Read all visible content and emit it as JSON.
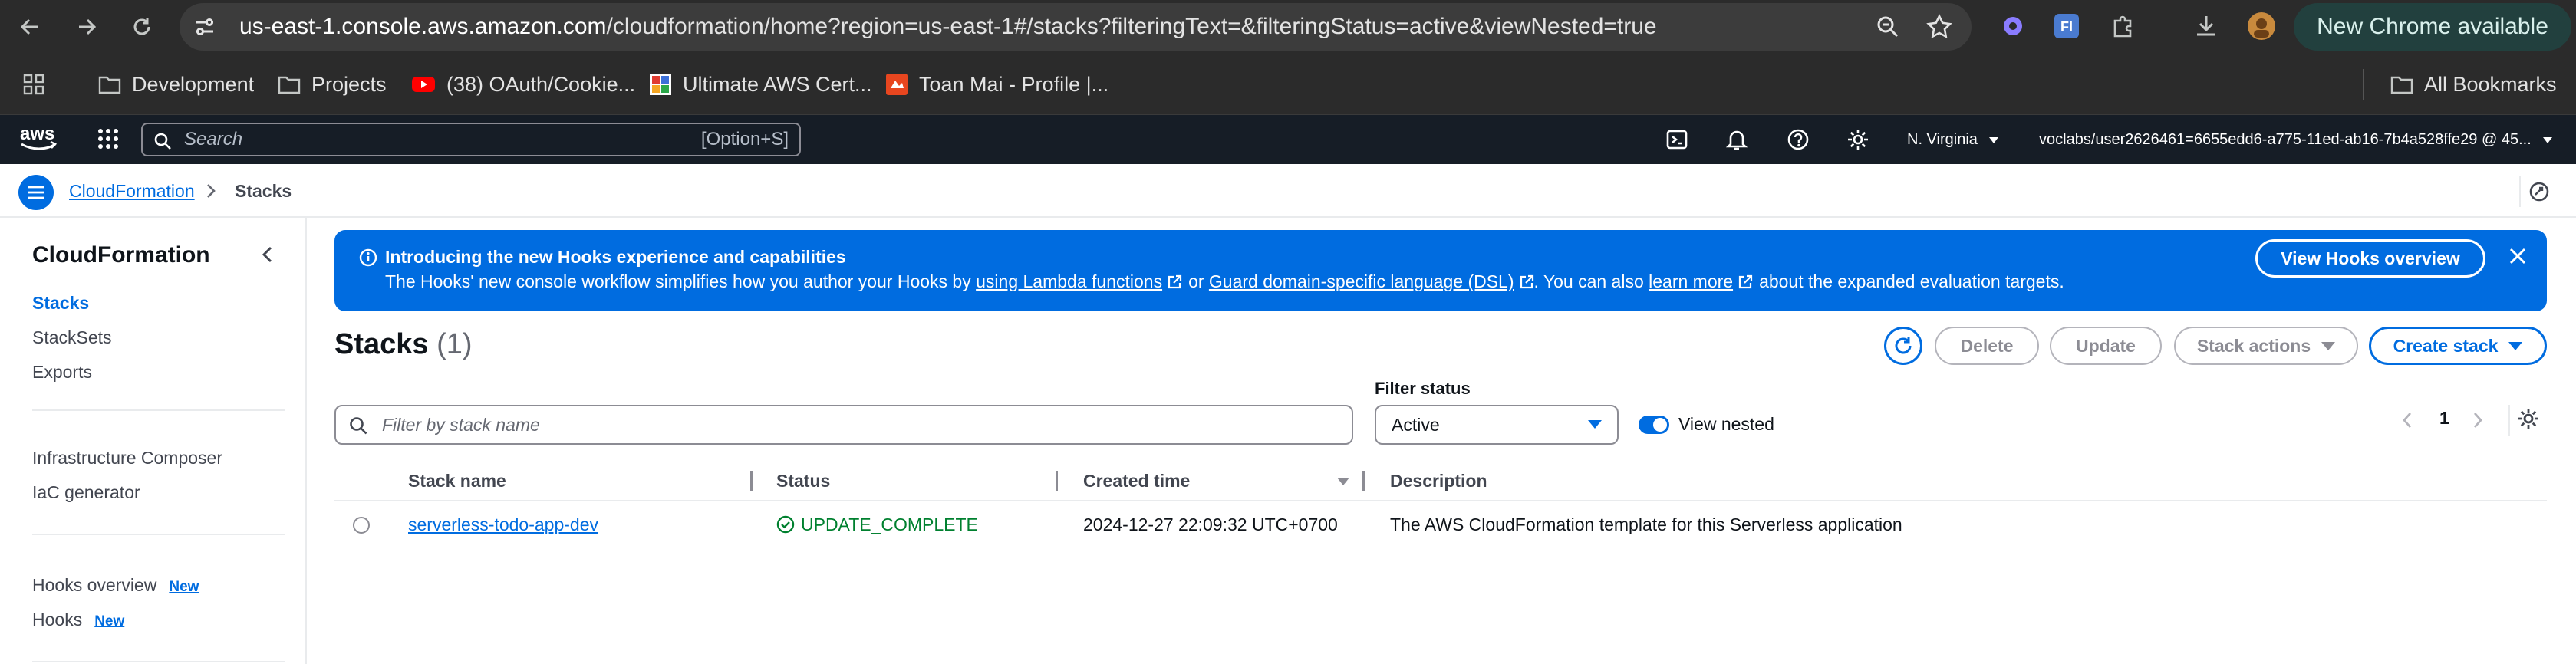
{
  "browser": {
    "url_host": "us-east-1.console.aws.amazon.com",
    "url_path": "/cloudformation/home?region=us-east-1#/stacks?filteringText=&filteringStatus=active&viewNested=true",
    "update_label": "New Chrome available"
  },
  "bookmarks": {
    "items": [
      {
        "label": "Development",
        "icon": "folder-icon"
      },
      {
        "label": "Projects",
        "icon": "folder-icon"
      },
      {
        "label": "(38) OAuth/Cookie...",
        "icon": "youtube-icon"
      },
      {
        "label": "Ultimate AWS Cert...",
        "icon": "site-icon"
      },
      {
        "label": "Toan Mai - Profile |...",
        "icon": "profile-icon"
      }
    ],
    "all_label": "All Bookmarks"
  },
  "aws_header": {
    "logo": "aws",
    "search_placeholder": "Search",
    "search_shortcut": "[Option+S]",
    "region": "N. Virginia",
    "account": "voclabs/user2626461=6655edd6-a775-11ed-ab16-7b4a528ffe29 @ 45..."
  },
  "breadcrumb": {
    "service": "CloudFormation",
    "current": "Stacks"
  },
  "sidenav": {
    "title": "CloudFormation",
    "items": [
      {
        "label": "Stacks",
        "active": true
      },
      {
        "label": "StackSets"
      },
      {
        "label": "Exports"
      },
      {
        "label": "Infrastructure Composer"
      },
      {
        "label": "IaC generator"
      },
      {
        "label": "Hooks overview",
        "badge": "New"
      },
      {
        "label": "Hooks",
        "badge": "New"
      }
    ]
  },
  "flash": {
    "title": "Introducing the new Hooks experience and capabilities",
    "msg_prefix": "The Hooks' new console workflow simplifies how you author your Hooks by",
    "link1": "using Lambda functions",
    "msg_or": "or",
    "link2": "Guard domain-specific language (DSL)",
    "msg_mid": ". You can also",
    "link3": "learn more",
    "msg_suffix": "about the expanded evaluation targets.",
    "button": "View Hooks overview"
  },
  "stacks": {
    "title": "Stacks",
    "count": "(1)",
    "actions": {
      "delete": "Delete",
      "update": "Update",
      "stack_actions": "Stack actions",
      "create": "Create stack"
    },
    "filter_placeholder": "Filter by stack name",
    "filter_status_label": "Filter status",
    "filter_status_value": "Active",
    "view_nested_label": "View nested",
    "view_nested": true,
    "page": "1",
    "columns": [
      "Stack name",
      "Status",
      "Created time",
      "Description"
    ],
    "rows": [
      {
        "name": "serverless-todo-app-dev",
        "status": "UPDATE_COMPLETE",
        "created": "2024-12-27 22:09:32 UTC+0700",
        "description": "The AWS CloudFormation template for this Serverless application"
      }
    ]
  },
  "colors": {
    "accent": "#006ce0",
    "success": "#00802f",
    "header_bg": "#161d26"
  }
}
